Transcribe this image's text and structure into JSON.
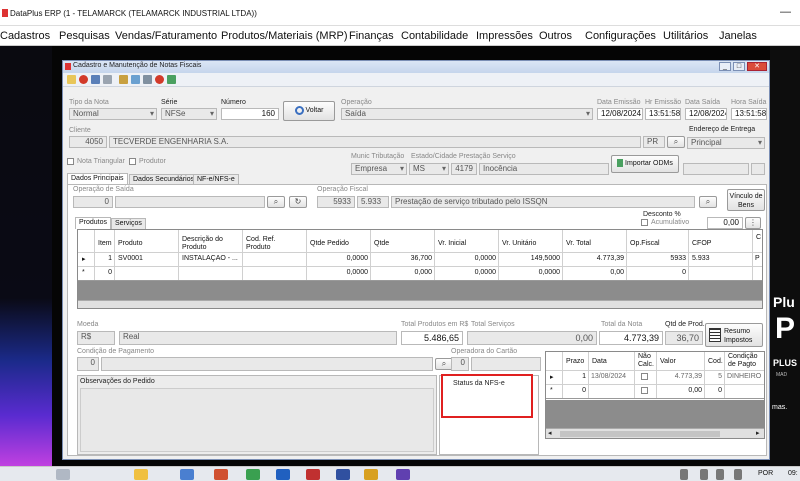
{
  "app": {
    "title": "DataPlus ERP (1 - TELAMARCK  (TELAMARCK INDUSTRIAL LTDA))",
    "min_label": "—"
  },
  "menu": [
    "Cadastros",
    "Pesquisas",
    "Vendas/Faturamento",
    "Produtos/Materiais (MRP)",
    "Finanças",
    "Contabilidade",
    "Impressões",
    "Outros",
    "Configurações",
    "Utilitários",
    "Janelas"
  ],
  "window": {
    "title": "Cadastro e Manutenção de Notas Fiscais",
    "buttons": [
      "_",
      "□",
      "✕"
    ]
  },
  "header": {
    "tipo_nota_label": "Tipo da Nota",
    "tipo_nota": "Normal",
    "serie_label": "Série",
    "serie": "NFSe",
    "numero_label": "Número",
    "numero": "160",
    "voltar_label": "Voltar",
    "operacao_label": "Operação",
    "operacao": "Saída",
    "data_emissao_label": "Data Emissão",
    "data_emissao": "12/08/2024",
    "hr_emissao_label": "Hr Emissão",
    "hr_emissao": "13:51:58",
    "data_saida_label": "Data Saída",
    "data_saida": "12/08/2024",
    "hora_saida_label": "Hora Saída",
    "hora_saida": "13:51:58"
  },
  "cliente": {
    "label": "Cliente",
    "codigo": "4050",
    "nome": "TECVERDE ENGENHARIA S.A.",
    "uf": "PR",
    "endereco_entrega_label": "Endereço de Entrega",
    "endereco_entrega": "Principal",
    "nota_triangular_label": "Nota Triangular",
    "produtor_label": "Produtor",
    "munic_label": "Munic Tributação",
    "munic": "Empresa",
    "estado_label": "Estado/Cidade Prestação Serviço",
    "estado": "MS",
    "cidade_codigo": "4179",
    "cidade": "Inocência",
    "importar_odms_label": "Importar ODMs"
  },
  "tabs": [
    "Dados Principais",
    "Dados Secundários",
    "NF-e/NFS-e"
  ],
  "operacao_saida": {
    "label": "Operação de Saída",
    "codigo": "0"
  },
  "operacao_fiscal": {
    "label": "Operação Fiscal",
    "codigo": "5933",
    "cfop": "5.933",
    "descricao": "Prestação de serviço tributado pelo ISSQN",
    "vinculo_label": "Vínculo de Bens"
  },
  "desconto": {
    "label": "Desconto %",
    "acumulativo_label": "Acumulativo",
    "valor": "0,00"
  },
  "subtabs": [
    "Produtos",
    "Serviços"
  ],
  "itens_grid": {
    "headers": [
      "Item",
      "Produto",
      "Descrição do Produto",
      "Cod. Ref. Produto",
      "Qtde Pedido",
      "Qtde",
      "Vr. Inicial",
      "Vr. Unitário",
      "Vr. Total",
      "Op.Fiscal",
      "CFOP",
      "C"
    ],
    "rows": [
      [
        "1",
        "SV0001",
        "INSTALAÇÃO - ...",
        "",
        "0,0000",
        "36,700",
        "0,0000",
        "149,5000",
        "4.773,39",
        "5933",
        "5.933",
        "P"
      ],
      [
        "0",
        "",
        "",
        "",
        "0,0000",
        "0,000",
        "0,0000",
        "0,0000",
        "0,00",
        "0",
        "",
        ""
      ]
    ]
  },
  "totais": {
    "moeda_label": "Moeda",
    "moeda_codigo": "R$",
    "moeda": "Real",
    "total_produtos_label": "Total Produtos em R$",
    "total_produtos": "5.486,65",
    "total_servicos_label": "Total Produtos em R$ Total Serviços",
    "total_servicos": "0,00",
    "total_nota_label": "Total da Nota",
    "total_nota": "4.773,39",
    "qtd_prod_label": "Qtd de Prod.",
    "qtd_prod": "36,70",
    "resumo_label": "Resumo Impostos"
  },
  "pagamento": {
    "condicao_label": "Condição de Pagamento",
    "condicao_codigo": "0",
    "operadora_label": "Operadora do Cartão",
    "operadora_codigo": "0"
  },
  "observacoes_label": "Observações do Pedido",
  "status_nfse_label": "Status da NFS-e",
  "parcelas_grid": {
    "headers": [
      "Prazo",
      "Data",
      "Não Calc.",
      "Valor",
      "Cod.",
      "Condição de Pagto"
    ],
    "rows": [
      [
        "1",
        "13/08/2024",
        "",
        "4.773,39",
        "5",
        "DINHEIRO"
      ],
      [
        "0",
        "",
        "",
        "0,00",
        "0",
        ""
      ]
    ]
  },
  "taskbar": {
    "lang": "POR",
    "clock": "09:"
  },
  "brand": {
    "line1": "Plu",
    "line2": "P",
    "line3": "PLUS",
    "line4": "MAD",
    "line5": "mas."
  },
  "colors": {
    "highlight_box": "#e02020",
    "grid_gray": "#8c8c8c",
    "window_border": "#7b8fb5"
  }
}
